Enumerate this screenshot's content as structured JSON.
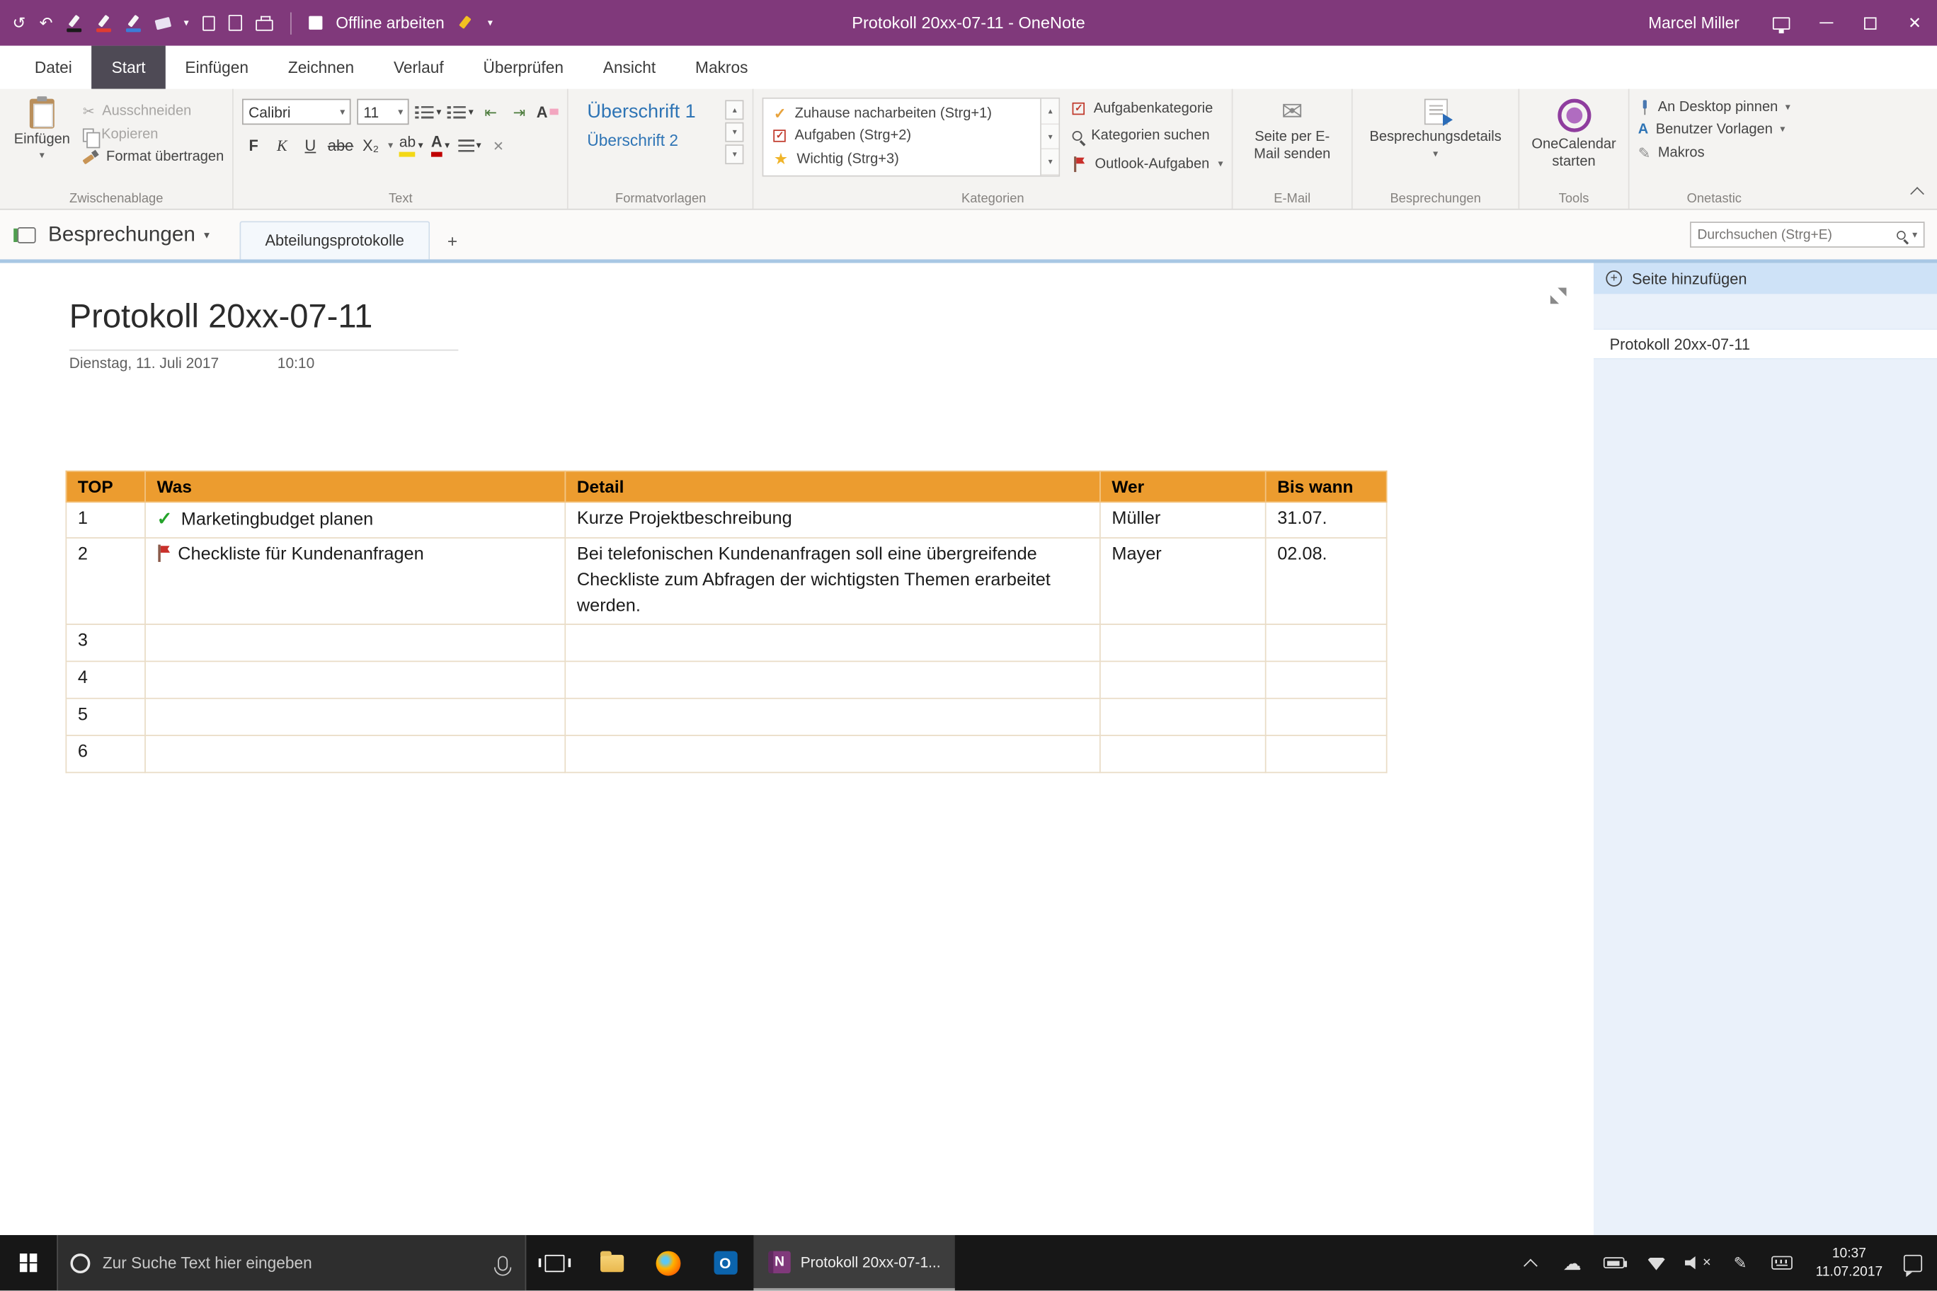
{
  "colors": {
    "titlebar": "#80397B",
    "table_header_orange": "#EC9C2F",
    "style_blue": "#2E74B5",
    "check_green": "#24A32A",
    "flag_red": "#C9302B",
    "section_line_blue": "#A8C7E4"
  },
  "titlebar": {
    "offline_label": "Offline arbeiten",
    "title": "Protokoll 20xx-07-11 - OneNote",
    "user": "Marcel Miller"
  },
  "ribbon_tabs": [
    "Datei",
    "Start",
    "Einfügen",
    "Zeichnen",
    "Verlauf",
    "Überprüfen",
    "Ansicht",
    "Makros"
  ],
  "ribbon": {
    "clipboard": {
      "label": "Zwischenablage",
      "paste": "Einfügen",
      "cut": "Ausschneiden",
      "copy": "Kopieren",
      "format_painter": "Format übertragen"
    },
    "text": {
      "label": "Text",
      "font_name": "Calibri",
      "font_size": "11",
      "bold": "F",
      "italic": "K",
      "underline": "U",
      "strikethrough": "abe",
      "subscript": "X₂",
      "highlight": "ab",
      "font_color": "A",
      "clear_format": "A"
    },
    "styles": {
      "label": "Formatvorlagen",
      "items": [
        "Überschrift 1",
        "Überschrift 2"
      ]
    },
    "tags": {
      "label": "Kategorien",
      "items": [
        "Zuhause nacharbeiten (Strg+1)",
        "Aufgaben (Strg+2)",
        "Wichtig (Strg+3)"
      ],
      "task_category": "Aufgabenkategorie",
      "find_tags": "Kategorien suchen",
      "outlook_tasks": "Outlook-Aufgaben"
    },
    "email": {
      "label": "E-Mail",
      "send_page": "Seite per E-Mail senden"
    },
    "meetings": {
      "label": "Besprechungen",
      "details": "Besprechungsdetails"
    },
    "tools": {
      "label": "Tools",
      "onecalendar": "OneCalendar starten"
    },
    "onetastic": {
      "label": "Onetastic",
      "pin": "An Desktop pinnen",
      "templates": "Benutzer Vorlagen",
      "macros": "Makros"
    }
  },
  "notebook_bar": {
    "notebook": "Besprechungen",
    "section": "Abteilungsprotokolle",
    "search_placeholder": "Durchsuchen (Strg+E)"
  },
  "sidebar": {
    "add_page": "Seite hinzufügen",
    "pages": [
      {
        "title": "Protokoll 20xx-07-11"
      }
    ]
  },
  "page": {
    "title": "Protokoll 20xx-07-11",
    "date": "Dienstag, 11. Juli 2017",
    "time": "10:10"
  },
  "table": {
    "headers": [
      "TOP",
      "Was",
      "Detail",
      "Wer",
      "Bis wann"
    ],
    "rows": [
      {
        "top": "1",
        "was": "Marketingbudget planen",
        "detail": "Kurze Projektbeschreibung",
        "wer": "Müller",
        "bis_wann": "31.07."
      },
      {
        "top": "2",
        "was": "Checkliste für Kundenanfragen",
        "detail": "Bei telefonischen Kundenanfragen soll eine übergreifende Checkliste zum Abfragen der wichtigsten Themen erarbeitet werden.",
        "wer": "Mayer",
        "bis_wann": "02.08."
      },
      {
        "top": "3",
        "was": "",
        "detail": "",
        "wer": "",
        "bis_wann": ""
      },
      {
        "top": "4",
        "was": "",
        "detail": "",
        "wer": "",
        "bis_wann": ""
      },
      {
        "top": "5",
        "was": "",
        "detail": "",
        "wer": "",
        "bis_wann": ""
      },
      {
        "top": "6",
        "was": "",
        "detail": "",
        "wer": "",
        "bis_wann": ""
      }
    ]
  },
  "taskbar": {
    "search_placeholder": "Zur Suche Text hier eingeben",
    "onenote_task": "Protokoll 20xx-07-1...",
    "time": "10:37",
    "date": "11.07.2017"
  },
  "icons": {
    "back": "↺",
    "undo": "↶",
    "dropdown": "▾",
    "up": "▴",
    "scissors": "✂",
    "check": "✓",
    "star": "★",
    "envelope": "✉",
    "plus": "+",
    "close": "✕",
    "cloud": "☁",
    "pencil": "✎",
    "outdent": "⇤",
    "indent": "⇥",
    "onenote_letter": "N",
    "outlook_letter": "O"
  }
}
